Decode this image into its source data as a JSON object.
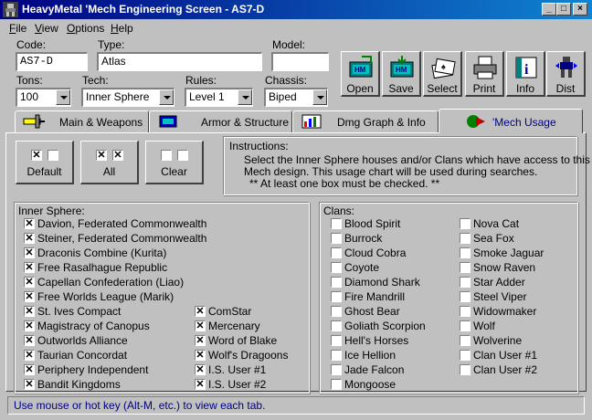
{
  "window": {
    "title": "HeavyMetal 'Mech Engineering Screen - AS7-D",
    "minimize": "_",
    "maximize": "□",
    "close": "×"
  },
  "menu": [
    "File",
    "View",
    "Options",
    "Help"
  ],
  "form": {
    "code_label": "Code:",
    "code_value": "AS7-D",
    "type_label": "Type:",
    "type_value": "Atlas",
    "model_label": "Model:",
    "model_value": "",
    "tons_label": "Tons:",
    "tons_value": "100",
    "tech_label": "Tech:",
    "tech_value": "Inner Sphere",
    "rules_label": "Rules:",
    "rules_value": "Level 1",
    "chassis_label": "Chassis:",
    "chassis_value": "Biped"
  },
  "toolbar": [
    {
      "label": "Open",
      "icon": "open-folder-icon"
    },
    {
      "label": "Save",
      "icon": "save-disk-icon"
    },
    {
      "label": "Select",
      "icon": "select-cards-icon"
    },
    {
      "label": "Print",
      "icon": "printer-icon"
    },
    {
      "label": "Info",
      "icon": "info-book-icon"
    },
    {
      "label": "Dist",
      "icon": "mech-distribution-icon"
    }
  ],
  "tabs": [
    {
      "label": "Main & Weapons",
      "icon": "weapons-icon"
    },
    {
      "label": "Armor & Structure",
      "icon": "armor-icon"
    },
    {
      "label": "Dmg Graph & Info",
      "icon": "graph-icon"
    },
    {
      "label": "'Mech Usage",
      "icon": "usage-icon",
      "active": true
    }
  ],
  "quick_buttons": [
    {
      "label": "Default",
      "marks": [
        "✕",
        ""
      ]
    },
    {
      "label": "All",
      "marks": [
        "✕",
        "✕"
      ]
    },
    {
      "label": "Clear",
      "marks": [
        "",
        ""
      ]
    }
  ],
  "instructions": {
    "heading": "Instructions:",
    "line1": "Select the Inner Sphere houses and/or Clans which have access to this",
    "line2": "Mech design. This usage chart will be used during searches.",
    "line3": "** At least one box must be checked. **"
  },
  "inner_sphere": {
    "heading": "Inner Sphere:",
    "col1": [
      {
        "label": "Davion, Federated Commonwealth",
        "checked": true
      },
      {
        "label": "Steiner, Federated Commonwealth",
        "checked": true
      },
      {
        "label": "Draconis Combine (Kurita)",
        "checked": true
      },
      {
        "label": "Free Rasalhague Republic",
        "checked": true
      },
      {
        "label": "Capellan Confederation (Liao)",
        "checked": true
      },
      {
        "label": "Free Worlds League (Marik)",
        "checked": true
      },
      {
        "label": "St. Ives Compact",
        "checked": true
      },
      {
        "label": "Magistracy of Canopus",
        "checked": true
      },
      {
        "label": "Outworlds Alliance",
        "checked": true
      },
      {
        "label": "Taurian Concordat",
        "checked": true
      },
      {
        "label": "Periphery Independent",
        "checked": true
      },
      {
        "label": "Bandit Kingdoms",
        "checked": true
      }
    ],
    "col2": [
      {
        "label": "ComStar",
        "checked": true
      },
      {
        "label": "Mercenary",
        "checked": true
      },
      {
        "label": "Word of Blake",
        "checked": true
      },
      {
        "label": "Wolf's Dragoons",
        "checked": true
      },
      {
        "label": "I.S. User #1",
        "checked": true
      },
      {
        "label": "I.S. User #2",
        "checked": true
      }
    ]
  },
  "clans": {
    "heading": "Clans:",
    "col1": [
      {
        "label": "Blood Spirit",
        "checked": false
      },
      {
        "label": "Burrock",
        "checked": false
      },
      {
        "label": "Cloud Cobra",
        "checked": false
      },
      {
        "label": "Coyote",
        "checked": false
      },
      {
        "label": "Diamond Shark",
        "checked": false
      },
      {
        "label": "Fire Mandrill",
        "checked": false
      },
      {
        "label": "Ghost Bear",
        "checked": false
      },
      {
        "label": "Goliath Scorpion",
        "checked": false
      },
      {
        "label": "Hell's Horses",
        "checked": false
      },
      {
        "label": "Ice Hellion",
        "checked": false
      },
      {
        "label": "Jade Falcon",
        "checked": false
      },
      {
        "label": "Mongoose",
        "checked": false
      }
    ],
    "col2": [
      {
        "label": "Nova Cat",
        "checked": false
      },
      {
        "label": "Sea Fox",
        "checked": false
      },
      {
        "label": "Smoke Jaguar",
        "checked": false
      },
      {
        "label": "Snow Raven",
        "checked": false
      },
      {
        "label": "Star Adder",
        "checked": false
      },
      {
        "label": "Steel Viper",
        "checked": false
      },
      {
        "label": "Widowmaker",
        "checked": false
      },
      {
        "label": "Wolf",
        "checked": false
      },
      {
        "label": "Wolverine",
        "checked": false
      },
      {
        "label": "Clan User #1",
        "checked": false
      },
      {
        "label": "Clan User #2",
        "checked": false
      }
    ]
  },
  "status": "Use mouse or hot key (Alt-M, etc.) to view each tab.",
  "colors": {
    "title_start": "#000080",
    "title_end": "#1084d0",
    "face": "#c0c0c0",
    "status_text": "#000080"
  }
}
